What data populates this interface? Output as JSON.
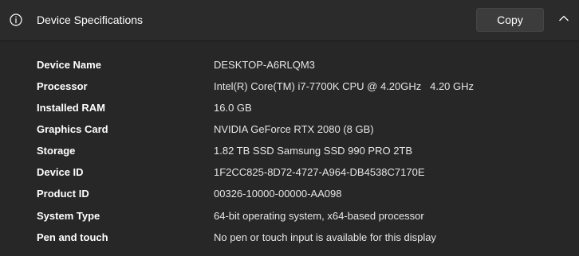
{
  "header": {
    "title": "Device Specifications",
    "copy_label": "Copy",
    "info_icon": "info-icon",
    "collapse_icon": "chevron-up-icon"
  },
  "specs": [
    {
      "label": "Device Name",
      "value": "DESKTOP-A6RLQM3"
    },
    {
      "label": "Processor",
      "value": "Intel(R) Core(TM) i7-7700K CPU @ 4.20GHz   4.20 GHz"
    },
    {
      "label": "Installed RAM",
      "value": "16.0 GB"
    },
    {
      "label": "Graphics Card",
      "value": "NVIDIA GeForce RTX 2080 (8 GB)"
    },
    {
      "label": "Storage",
      "value": "1.82 TB SSD Samsung SSD 990 PRO 2TB"
    },
    {
      "label": "Device ID",
      "value": "1F2CC825-8D72-4727-A964-DB4538C7170E"
    },
    {
      "label": "Product ID",
      "value": "00326-10000-00000-AA098"
    },
    {
      "label": "System Type",
      "value": "64-bit operating system, x64-based processor"
    },
    {
      "label": "Pen and touch",
      "value": "No pen or touch input is available for this display"
    }
  ]
}
